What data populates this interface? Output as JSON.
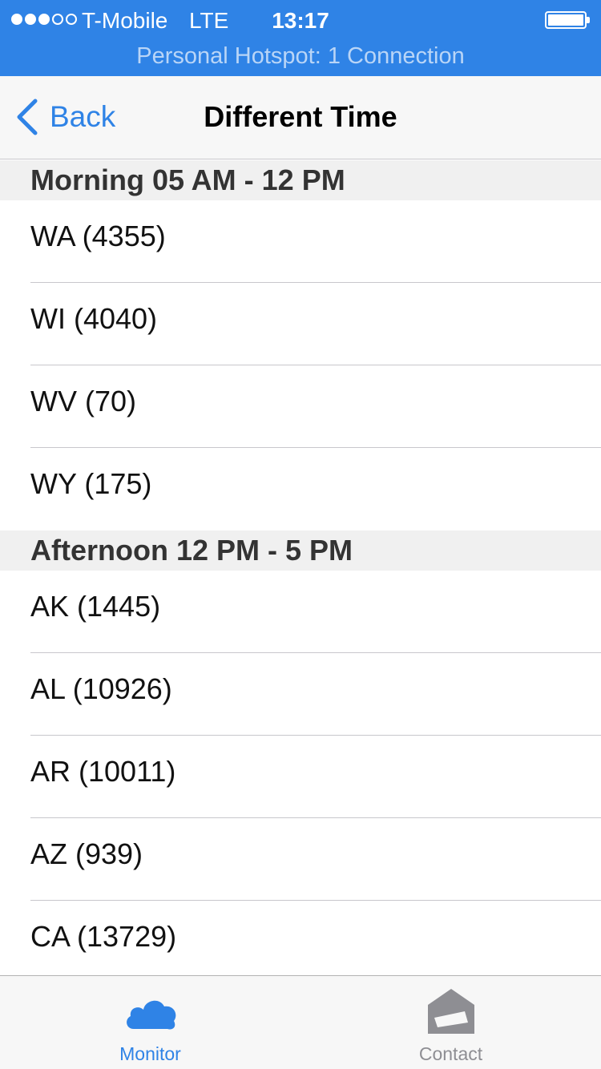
{
  "status_bar": {
    "carrier": "T-Mobile",
    "network": "LTE",
    "time": "13:17",
    "hotspot": "Personal Hotspot: 1 Connection"
  },
  "nav": {
    "back_label": "Back",
    "title": "Different Time"
  },
  "sections": [
    {
      "header": "Morning 05 AM - 12 PM",
      "rows": [
        "WA (4355)",
        "WI (4040)",
        "WV (70)",
        "WY (175)"
      ]
    },
    {
      "header": "Afternoon 12 PM - 5 PM",
      "rows": [
        "AK (1445)",
        "AL (10926)",
        "AR (10011)",
        "AZ (939)",
        "CA (13729)"
      ]
    }
  ],
  "tabbar": {
    "tabs": [
      {
        "label": "Monitor",
        "icon": "cloud-icon",
        "active": true
      },
      {
        "label": "Contact",
        "icon": "envelope-icon",
        "active": false
      }
    ]
  },
  "colors": {
    "accent": "#2f83e6",
    "status_bar": "#2f83e6",
    "inactive_tab": "#8e8e93"
  }
}
